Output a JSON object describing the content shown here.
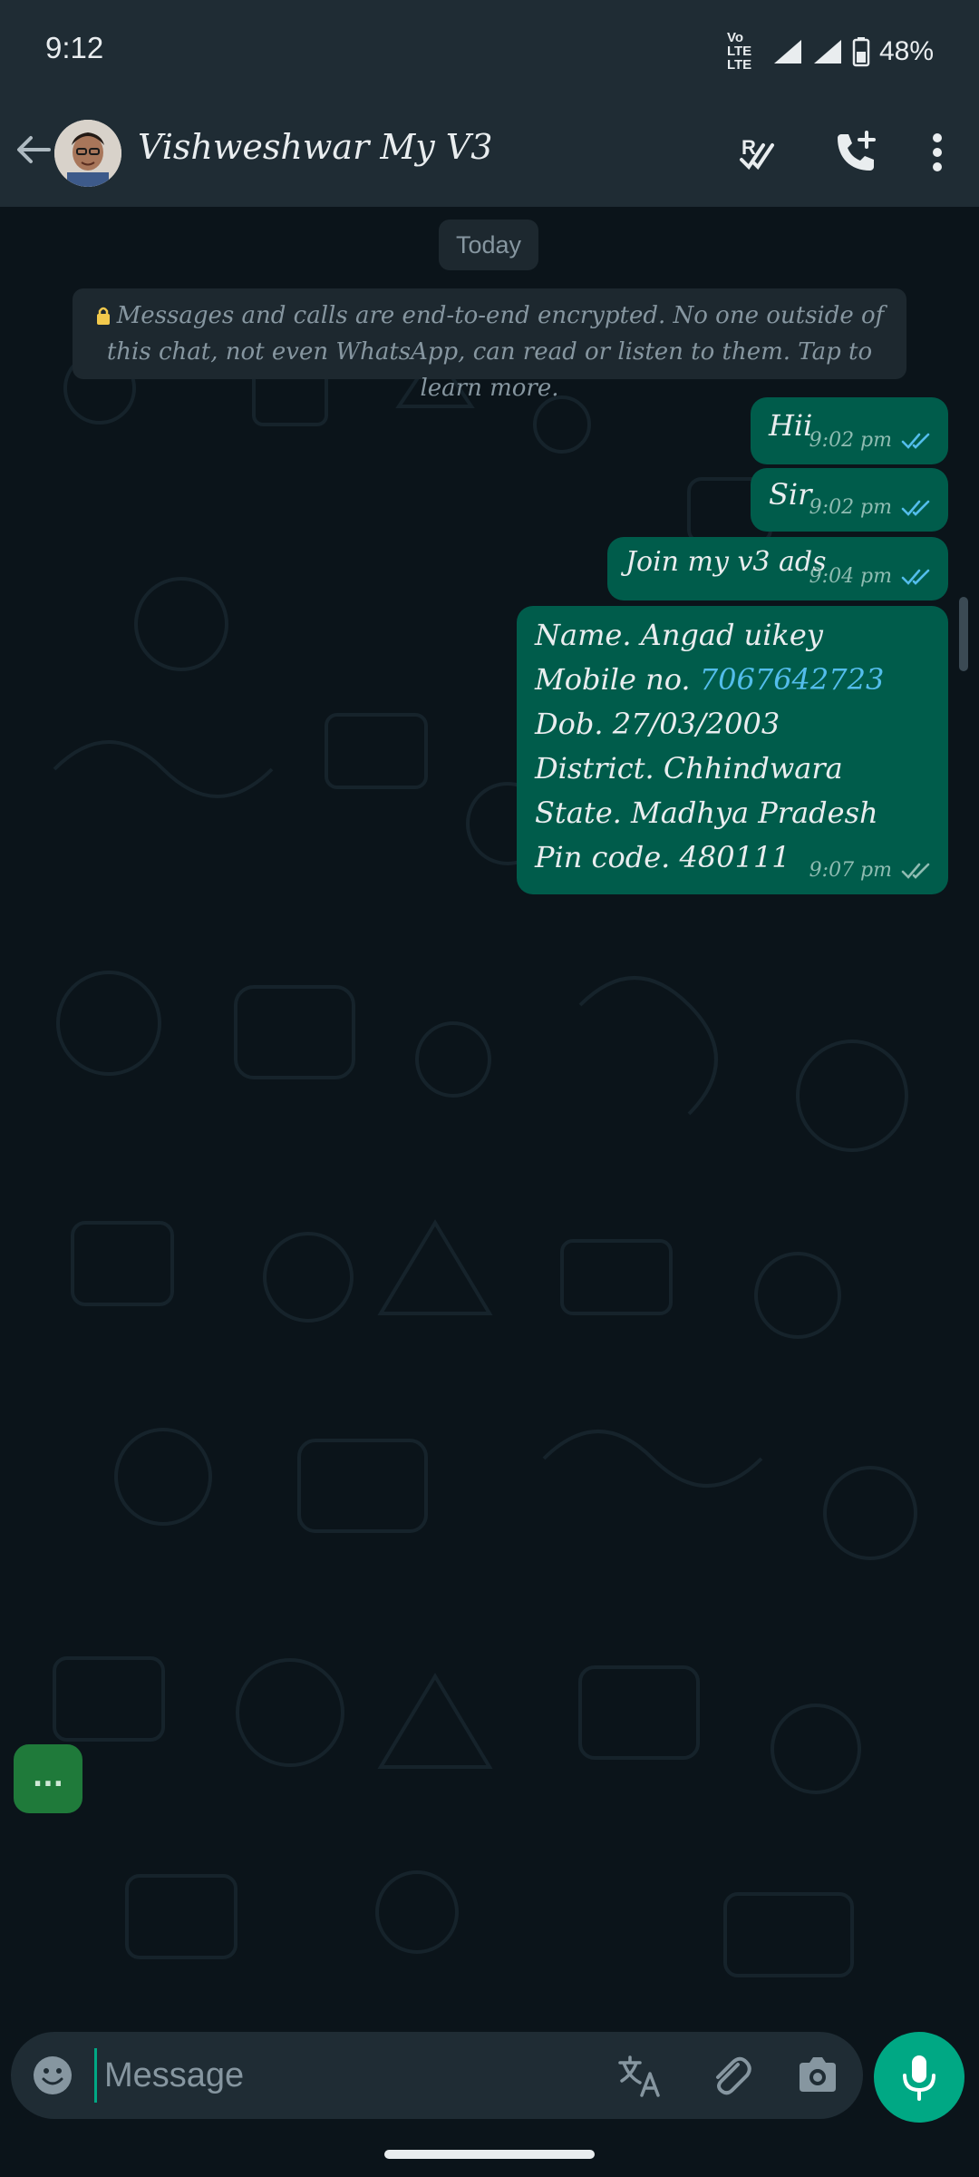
{
  "status_bar": {
    "time": "9:12",
    "network_label": "Vo LTE LTE",
    "battery": "48%"
  },
  "header": {
    "contact_name": "Vishweshwar My V3"
  },
  "chat": {
    "date_label": "Today",
    "encryption_notice": "Messages and calls are end-to-end encrypted. No one outside of this chat, not even WhatsApp, can read or listen to them. Tap to learn more.",
    "messages": [
      {
        "text": "Hii",
        "time": "9:02 pm",
        "status": "read"
      },
      {
        "text": "Sir",
        "time": "9:02 pm",
        "status": "read"
      },
      {
        "text": "Join my v3 ads",
        "time": "9:04 pm",
        "status": "read"
      },
      {
        "lines": [
          "Name. Angad uikey",
          "Mobile no.",
          "Dob. 27/03/2003",
          "District. Chhindwara",
          "State. Madhya Pradesh",
          "Pin code.  480111"
        ],
        "phone": "7067642723",
        "time": "9:07 pm",
        "status": "delivered"
      }
    ]
  },
  "typing_indicator": "...",
  "input": {
    "placeholder": "Message"
  },
  "colors": {
    "outgoing_bubble": "#005c4b",
    "accent": "#00a884",
    "read_ticks": "#53bdeb",
    "header_bg": "#1f2c34",
    "chat_bg": "#0b141a"
  },
  "icons": [
    "back-arrow-icon",
    "avatar",
    "read-all-icon",
    "add-call-icon",
    "more-vert-icon",
    "lock-icon",
    "double-check-icon",
    "emoji-icon",
    "translate-icon",
    "attach-icon",
    "camera-icon",
    "mic-icon"
  ]
}
